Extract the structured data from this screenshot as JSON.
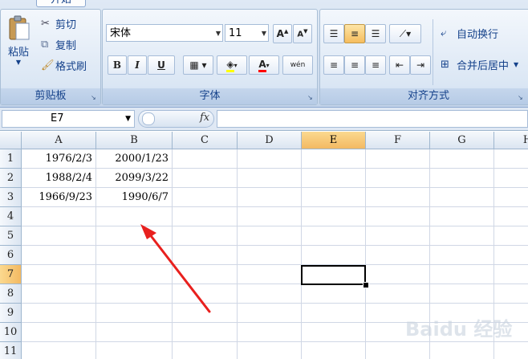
{
  "ribbon": {
    "tabs": {
      "active": "开始"
    },
    "clipboard": {
      "label": "剪贴板",
      "paste": "粘贴",
      "cut": "剪切",
      "copy": "复制",
      "format_painter": "格式刷"
    },
    "font": {
      "label": "字体",
      "name": "宋体",
      "size": "11",
      "bold": "B",
      "italic": "I",
      "underline": "U",
      "wen": "wén"
    },
    "alignment": {
      "label": "对齐方式",
      "wrap_text": "自动换行",
      "merge_center": "合并后居中"
    }
  },
  "formula_bar": {
    "cell_ref": "E7",
    "fx": "fx",
    "value": ""
  },
  "sheet": {
    "columns": [
      "A",
      "B",
      "C",
      "D",
      "E",
      "F",
      "G",
      "H"
    ],
    "rows": [
      "1",
      "2",
      "3",
      "4",
      "5",
      "6",
      "7",
      "8",
      "9",
      "10",
      "11"
    ],
    "cells": [
      {
        "ref": "A1",
        "value": "1976/2/3"
      },
      {
        "ref": "B1",
        "value": "2000/1/23"
      },
      {
        "ref": "A2",
        "value": "1988/2/4"
      },
      {
        "ref": "B2",
        "value": "2099/3/22"
      },
      {
        "ref": "A3",
        "value": "1966/9/23"
      },
      {
        "ref": "B3",
        "value": "1990/6/7"
      }
    ],
    "selected_cell": "E7"
  },
  "watermark": "Baidu 经验",
  "colors": {
    "arrow": "#e8201e",
    "selection_header": "#f3b962",
    "ribbon": "#dae6f4"
  }
}
